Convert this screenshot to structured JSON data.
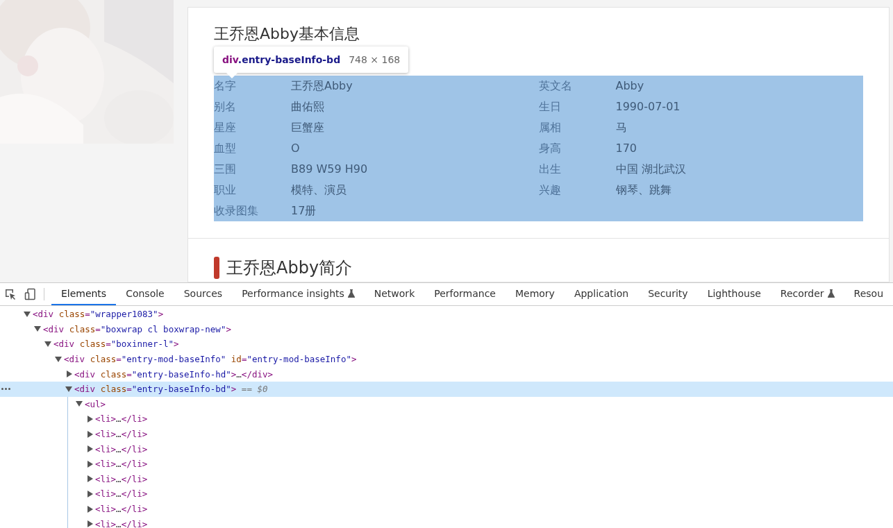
{
  "page": {
    "info_title": "王乔恩Abby基本信息",
    "info_rows": [
      {
        "items": [
          {
            "label": "名字",
            "value": "王乔恩Abby"
          },
          {
            "label": "英文名",
            "value": "Abby"
          }
        ]
      },
      {
        "items": [
          {
            "label": "别名",
            "value": "曲佑熙"
          },
          {
            "label": "生日",
            "value": "1990-07-01"
          }
        ]
      },
      {
        "items": [
          {
            "label": "星座",
            "value": "巨蟹座"
          },
          {
            "label": "属相",
            "value": "马"
          }
        ]
      },
      {
        "items": [
          {
            "label": "血型",
            "value": "O"
          },
          {
            "label": "身高",
            "value": "170"
          }
        ]
      },
      {
        "items": [
          {
            "label": "三围",
            "value": "B89 W59 H90"
          },
          {
            "label": "出生",
            "value": "中国 湖北武汉"
          }
        ]
      },
      {
        "items": [
          {
            "label": "职业",
            "value": "模特、演员"
          },
          {
            "label": "兴趣",
            "value": "钢琴、跳舞"
          }
        ]
      },
      {
        "items": [
          {
            "label": "收录图集",
            "value": "17册"
          }
        ]
      }
    ],
    "intro_title": "王乔恩Abby简介"
  },
  "inspect_tooltip": {
    "selector_tag": "div",
    "selector_class": ".entry-baseInfo-bd",
    "size": "748 × 168"
  },
  "devtools": {
    "tabs": [
      {
        "label": "Elements",
        "selected": true
      },
      {
        "label": "Console",
        "selected": false
      },
      {
        "label": "Sources",
        "selected": false
      },
      {
        "label": "Performance insights",
        "selected": false,
        "experimental": true
      },
      {
        "label": "Network",
        "selected": false
      },
      {
        "label": "Performance",
        "selected": false
      },
      {
        "label": "Memory",
        "selected": false
      },
      {
        "label": "Application",
        "selected": false
      },
      {
        "label": "Security",
        "selected": false
      },
      {
        "label": "Lighthouse",
        "selected": false
      },
      {
        "label": "Recorder",
        "selected": false,
        "experimental": true
      },
      {
        "label": "Resou",
        "selected": false
      }
    ],
    "dom_tree": [
      {
        "expanded": true,
        "selected": false,
        "tokens": [
          {
            "kind": "t",
            "text": "<div"
          },
          {
            "kind": "a",
            "text": " class"
          },
          {
            "kind": "t",
            "text": "="
          },
          {
            "kind": "v",
            "text": "\"wrapper1083\""
          },
          {
            "kind": "t",
            "text": ">"
          }
        ],
        "children": [
          {
            "expanded": true,
            "selected": false,
            "tokens": [
              {
                "kind": "t",
                "text": "<div"
              },
              {
                "kind": "a",
                "text": " class"
              },
              {
                "kind": "t",
                "text": "="
              },
              {
                "kind": "v",
                "text": "\"boxwrap cl boxwrap-new\""
              },
              {
                "kind": "t",
                "text": ">"
              }
            ],
            "children": [
              {
                "expanded": true,
                "selected": false,
                "tokens": [
                  {
                    "kind": "t",
                    "text": "<div"
                  },
                  {
                    "kind": "a",
                    "text": " class"
                  },
                  {
                    "kind": "t",
                    "text": "="
                  },
                  {
                    "kind": "v",
                    "text": "\"boxinner-l\""
                  },
                  {
                    "kind": "t",
                    "text": ">"
                  }
                ],
                "children": [
                  {
                    "expanded": true,
                    "selected": false,
                    "tokens": [
                      {
                        "kind": "t",
                        "text": "<div"
                      },
                      {
                        "kind": "a",
                        "text": " class"
                      },
                      {
                        "kind": "t",
                        "text": "="
                      },
                      {
                        "kind": "v",
                        "text": "\"entry-mod-baseInfo\""
                      },
                      {
                        "kind": "a",
                        "text": " id"
                      },
                      {
                        "kind": "t",
                        "text": "="
                      },
                      {
                        "kind": "v",
                        "text": "\"entry-mod-baseInfo\""
                      },
                      {
                        "kind": "t",
                        "text": ">"
                      }
                    ],
                    "children": [
                      {
                        "expanded": false,
                        "selected": false,
                        "tokens": [
                          {
                            "kind": "t",
                            "text": "<div"
                          },
                          {
                            "kind": "a",
                            "text": " class"
                          },
                          {
                            "kind": "t",
                            "text": "="
                          },
                          {
                            "kind": "v",
                            "text": "\"entry-baseInfo-hd\""
                          },
                          {
                            "kind": "t",
                            "text": ">"
                          },
                          {
                            "kind": "x",
                            "text": "…"
                          },
                          {
                            "kind": "t",
                            "text": "</div>"
                          }
                        ]
                      },
                      {
                        "expanded": true,
                        "selected": true,
                        "tokens": [
                          {
                            "kind": "t",
                            "text": "<div"
                          },
                          {
                            "kind": "a",
                            "text": " class"
                          },
                          {
                            "kind": "t",
                            "text": "="
                          },
                          {
                            "kind": "v",
                            "text": "\"entry-baseInfo-bd\""
                          },
                          {
                            "kind": "t",
                            "text": ">"
                          },
                          {
                            "kind": "c",
                            "text": " == $0"
                          }
                        ],
                        "children": [
                          {
                            "expanded": true,
                            "selected": false,
                            "tokens": [
                              {
                                "kind": "t",
                                "text": "<ul>"
                              }
                            ],
                            "children": [
                              {
                                "expanded": false,
                                "selected": false,
                                "tokens": [
                                  {
                                    "kind": "t",
                                    "text": "<li>"
                                  },
                                  {
                                    "kind": "x",
                                    "text": "…"
                                  },
                                  {
                                    "kind": "t",
                                    "text": "</li>"
                                  }
                                ]
                              },
                              {
                                "expanded": false,
                                "selected": false,
                                "tokens": [
                                  {
                                    "kind": "t",
                                    "text": "<li>"
                                  },
                                  {
                                    "kind": "x",
                                    "text": "…"
                                  },
                                  {
                                    "kind": "t",
                                    "text": "</li>"
                                  }
                                ]
                              },
                              {
                                "expanded": false,
                                "selected": false,
                                "tokens": [
                                  {
                                    "kind": "t",
                                    "text": "<li>"
                                  },
                                  {
                                    "kind": "x",
                                    "text": "…"
                                  },
                                  {
                                    "kind": "t",
                                    "text": "</li>"
                                  }
                                ]
                              },
                              {
                                "expanded": false,
                                "selected": false,
                                "tokens": [
                                  {
                                    "kind": "t",
                                    "text": "<li>"
                                  },
                                  {
                                    "kind": "x",
                                    "text": "…"
                                  },
                                  {
                                    "kind": "t",
                                    "text": "</li>"
                                  }
                                ]
                              },
                              {
                                "expanded": false,
                                "selected": false,
                                "tokens": [
                                  {
                                    "kind": "t",
                                    "text": "<li>"
                                  },
                                  {
                                    "kind": "x",
                                    "text": "…"
                                  },
                                  {
                                    "kind": "t",
                                    "text": "</li>"
                                  }
                                ]
                              },
                              {
                                "expanded": false,
                                "selected": false,
                                "tokens": [
                                  {
                                    "kind": "t",
                                    "text": "<li>"
                                  },
                                  {
                                    "kind": "x",
                                    "text": "…"
                                  },
                                  {
                                    "kind": "t",
                                    "text": "</li>"
                                  }
                                ]
                              },
                              {
                                "expanded": false,
                                "selected": false,
                                "tokens": [
                                  {
                                    "kind": "t",
                                    "text": "<li>"
                                  },
                                  {
                                    "kind": "x",
                                    "text": "…"
                                  },
                                  {
                                    "kind": "t",
                                    "text": "</li>"
                                  }
                                ]
                              },
                              {
                                "expanded": false,
                                "selected": false,
                                "tokens": [
                                  {
                                    "kind": "t",
                                    "text": "<li>"
                                  },
                                  {
                                    "kind": "x",
                                    "text": "…"
                                  },
                                  {
                                    "kind": "t",
                                    "text": "</li>"
                                  }
                                ]
                              }
                            ]
                          }
                        ]
                      }
                    ]
                  }
                ]
              }
            ]
          }
        ]
      }
    ]
  }
}
